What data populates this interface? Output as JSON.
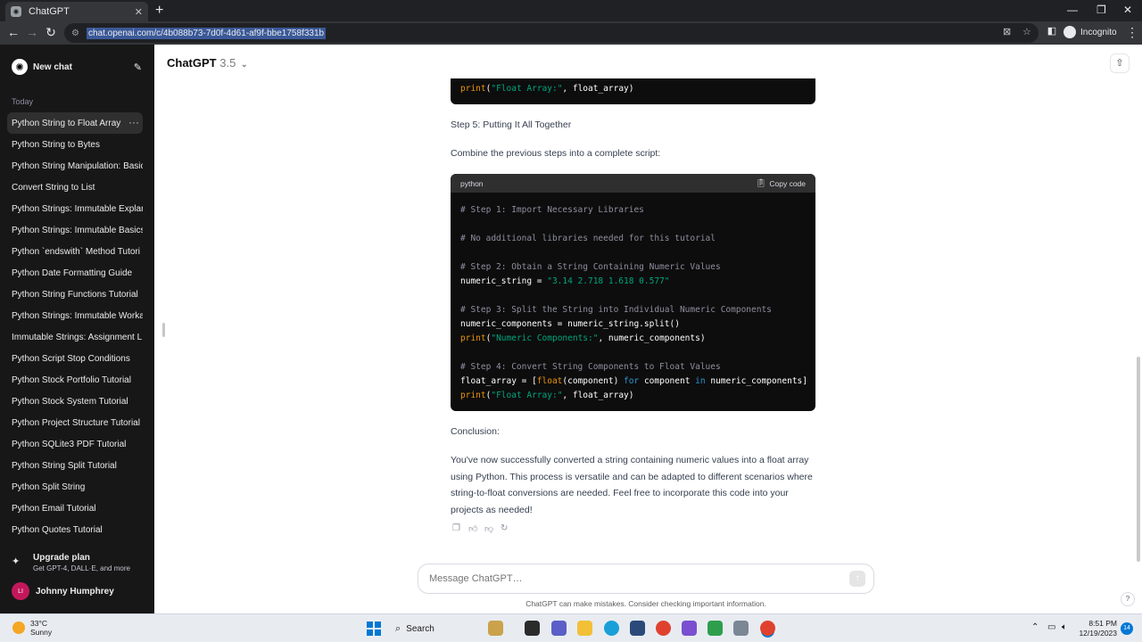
{
  "browser": {
    "tab_title": "ChatGPT",
    "url": "chat.openai.com/c/4b088b73-7d0f-4d61-af9f-bbe1758f331b",
    "profile_label": "Incognito"
  },
  "sidebar": {
    "new_chat_label": "New chat",
    "section_label": "Today",
    "history": [
      {
        "label": "Python String to Float Array",
        "active": true
      },
      {
        "label": "Python String to Bytes"
      },
      {
        "label": "Python String Manipulation: Basic"
      },
      {
        "label": "Convert String to List"
      },
      {
        "label": "Python Strings: Immutable Explan"
      },
      {
        "label": "Python Strings: Immutable Basics"
      },
      {
        "label": "Python `endswith` Method Tutori"
      },
      {
        "label": "Python Date Formatting Guide"
      },
      {
        "label": "Python String Functions Tutorial"
      },
      {
        "label": "Python Strings: Immutable Worka"
      },
      {
        "label": "Immutable Strings: Assignment L"
      },
      {
        "label": "Python Script Stop Conditions"
      },
      {
        "label": "Python Stock Portfolio Tutorial"
      },
      {
        "label": "Python Stock System Tutorial"
      },
      {
        "label": "Python Project Structure Tutorial"
      },
      {
        "label": "Python SQLite3 PDF Tutorial"
      },
      {
        "label": "Python String Split Tutorial"
      },
      {
        "label": "Python Split String"
      },
      {
        "label": "Python Email Tutorial"
      },
      {
        "label": "Python Quotes Tutorial"
      }
    ],
    "upgrade_title": "Upgrade plan",
    "upgrade_subtitle": "Get GPT-4, DALL·E, and more",
    "user_initials": "LI",
    "user_name": "Johnny Humphrey"
  },
  "header": {
    "model_name": "ChatGPT",
    "model_version": "3.5"
  },
  "conversation": {
    "top_code_line": {
      "fn": "print",
      "str": "\"Float Array:\"",
      "rest": ", float_array)"
    },
    "step5_heading": "Step 5: Putting It All Together",
    "step5_intro": "Combine the previous steps into a complete script:",
    "code_language": "python",
    "copy_label": "Copy code",
    "code": {
      "c1": "# Step 1: Import Necessary Libraries",
      "c2": "# No additional libraries needed for this tutorial",
      "c3": "# Step 2: Obtain a String Containing Numeric Values",
      "l4a": "numeric_string = ",
      "l4s": "\"3.14 2.718 1.618 0.577\"",
      "c5": "# Step 3: Split the String into Individual Numeric Components",
      "l6": "numeric_components = numeric_string.split()",
      "l7f": "print",
      "l7s": "\"Numeric Components:\"",
      "l7r": ", numeric_components)",
      "c8": "# Step 4: Convert String Components to Float Values",
      "l9a": "float_array = [",
      "l9f": "float",
      "l9b": "(component) ",
      "l9k1": "for",
      "l9c": " component ",
      "l9k2": "in",
      "l9d": " numeric_components]",
      "l10f": "print",
      "l10s": "\"Float Array:\"",
      "l10r": ", float_array)"
    },
    "conclusion_heading": "Conclusion:",
    "conclusion_text": "You've now successfully converted a string containing numeric values into a float array using Python. This process is versatile and can be adapted to different scenarios where string-to-float conversions are needed. Feel free to incorporate this code into your projects as needed!"
  },
  "composer": {
    "placeholder": "Message ChatGPT…",
    "disclaimer": "ChatGPT can make mistakes. Consider checking important information."
  },
  "taskbar": {
    "temperature": "33°C",
    "weather": "Sunny",
    "search_label": "Search",
    "time": "8:51 PM",
    "date": "12/19/2023",
    "notification_count": "14"
  },
  "colors": {
    "sidebar_bg": "#171717",
    "code_bg": "#0d0d0d",
    "code_string": "#00a67d",
    "code_function": "#e9950c",
    "code_keyword": "#2e95d3",
    "code_comment": "#8e8ea0"
  }
}
